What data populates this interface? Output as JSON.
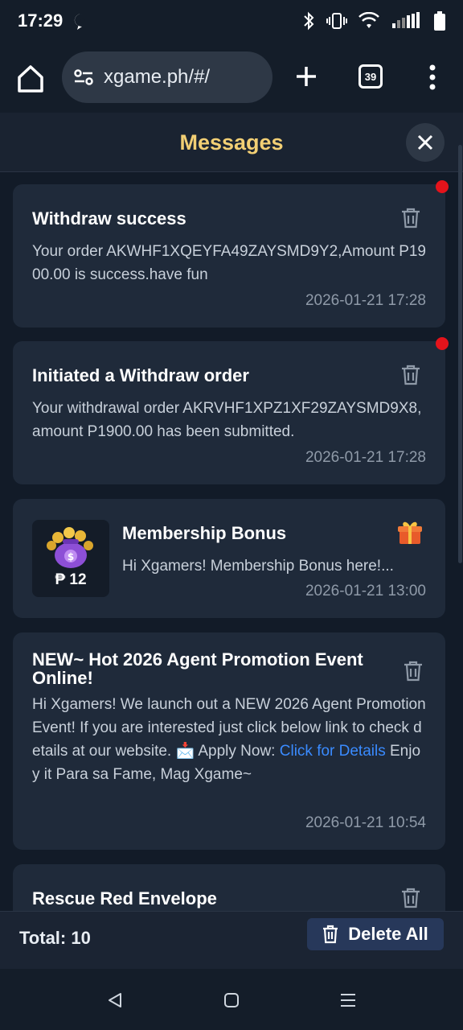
{
  "status_bar": {
    "time": "17:29"
  },
  "browser": {
    "url": "xgame.ph/#/",
    "tab_count": "39"
  },
  "modal": {
    "title": "Messages"
  },
  "messages": [
    {
      "title": "Withdraw success",
      "body": "Your order AKWHF1XQEYFA49ZAYSMD9Y2,Amount P1900.00 is success.have fun",
      "time": "2026-01-21 17:28",
      "unread": true
    },
    {
      "title": "Initiated a Withdraw order",
      "body": "Your withdrawal order AKRVHF1XPZ1XF29ZAYSMD9X8,amount P1900.00 has been submitted.",
      "time": "2026-01-21 17:28",
      "unread": true
    },
    {
      "title": "Membership Bonus",
      "body": "Hi Xgamers! Membership Bonus here!...",
      "time": "2026-01-21 13:00",
      "amount": "₱ 12"
    },
    {
      "title": "NEW~ Hot 2026 Agent Promotion Event Online!",
      "body_pre": "Hi Xgamers! We launch out a NEW 2026 Agent Promotion Event! If you are interested just click below link to check details at our website. 📩 Apply Now: ",
      "link": "Click for Details",
      "body_post": " Enjoy it Para sa Fame, Mag Xgame~",
      "time": "2026-01-21 10:54"
    },
    {
      "title": "Rescue Red Envelope"
    }
  ],
  "footer": {
    "total": "Total: 10",
    "delete_all": "Delete All"
  },
  "colors": {
    "accent_title": "#f2cf74",
    "unread_dot": "#e4131b",
    "link": "#3a8bff",
    "card_bg": "#1f2a3a"
  }
}
